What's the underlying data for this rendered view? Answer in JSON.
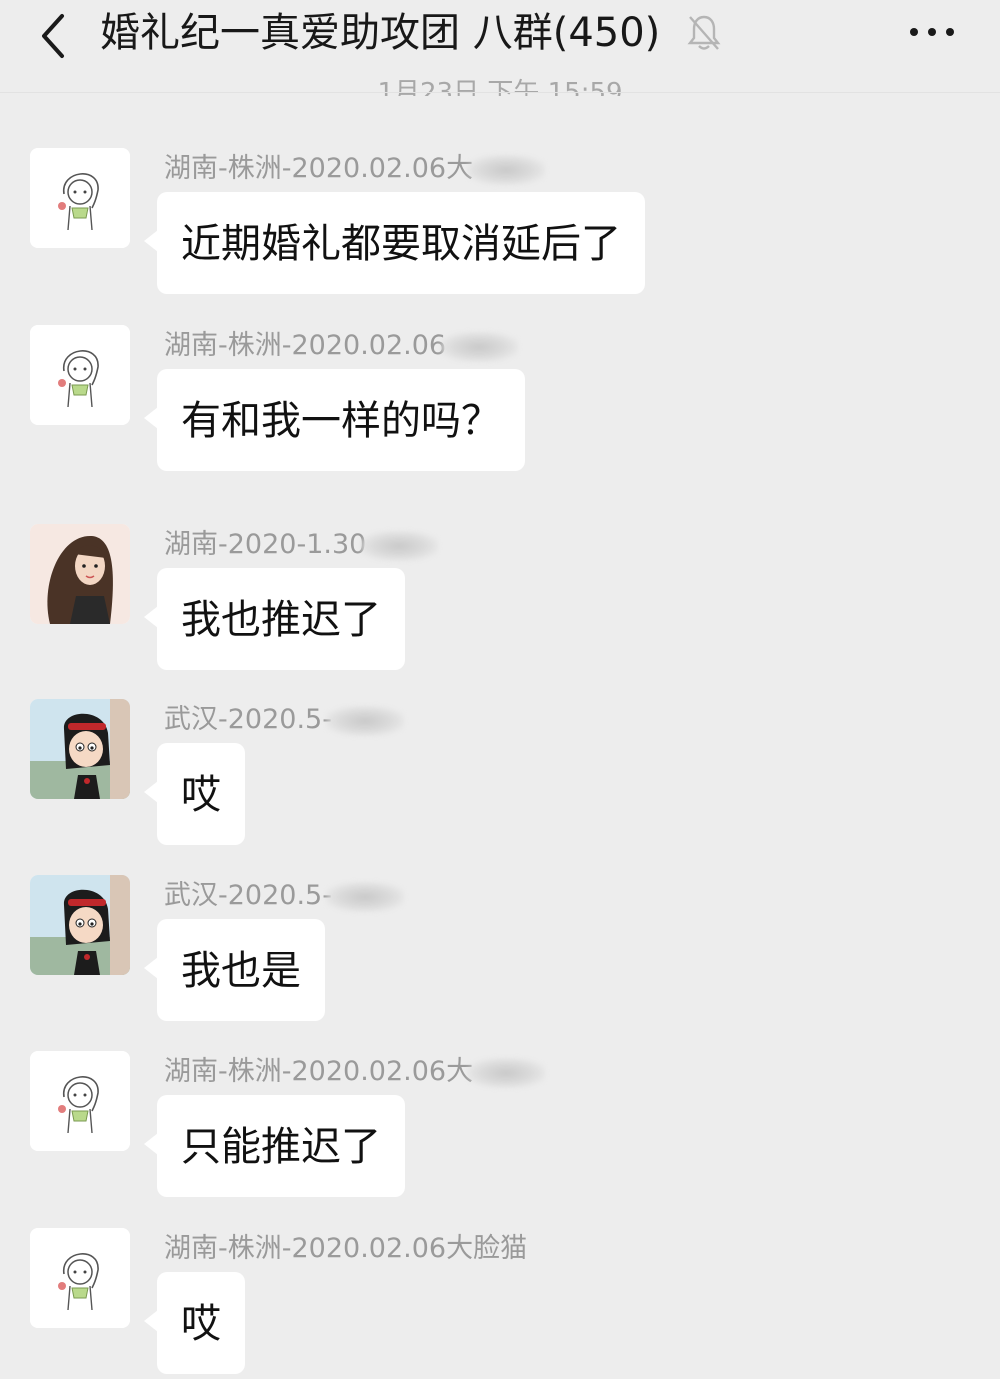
{
  "header": {
    "title": "婚礼纪一真爱助攻团 八群(450)",
    "back_icon": "chevron-left-icon",
    "mute_icon": "bell-off-icon",
    "more_icon": "more-dots-icon"
  },
  "timestamp": "1月23日 下午 15:59",
  "messages": [
    {
      "avatar": "girl-sketch-avatar",
      "sender": "湖南-株洲-2020.02.06大",
      "text": "近期婚礼都要取消延后了"
    },
    {
      "avatar": "girl-sketch-avatar",
      "sender": "湖南-株洲-2020.02.06",
      "text": "有和我一样的吗？"
    },
    {
      "avatar": "princess-avatar",
      "sender": "湖南-2020-1.30",
      "text": "我也推迟了"
    },
    {
      "avatar": "cartoon-girl-avatar",
      "sender": "武汉-2020.5-",
      "text": "哎"
    },
    {
      "avatar": "cartoon-girl-avatar",
      "sender": "武汉-2020.5-",
      "text": "我也是"
    },
    {
      "avatar": "girl-sketch-avatar",
      "sender": "湖南-株洲-2020.02.06大",
      "text": "只能推迟了"
    },
    {
      "avatar": "girl-sketch-avatar",
      "sender": "湖南-株洲-2020.02.06大脸猫",
      "text": "哎"
    }
  ]
}
